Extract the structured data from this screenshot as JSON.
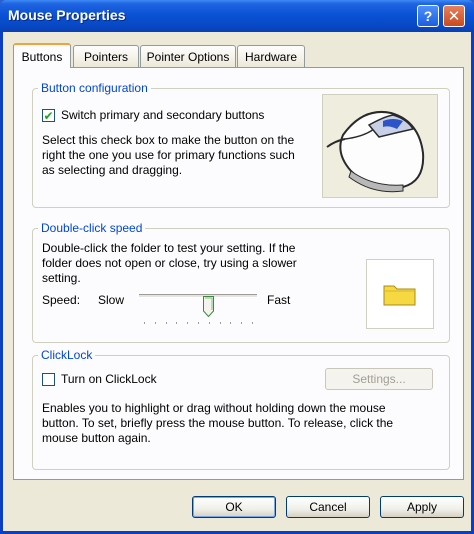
{
  "window": {
    "title": "Mouse Properties",
    "help_glyph": "?",
    "close_glyph": "✕"
  },
  "tabs": [
    {
      "label": "Buttons",
      "active": true
    },
    {
      "label": "Pointers",
      "active": false
    },
    {
      "label": "Pointer Options",
      "active": false
    },
    {
      "label": "Hardware",
      "active": false
    }
  ],
  "button_config": {
    "title": "Button configuration",
    "checkbox_label": "Switch primary and secondary buttons",
    "checked": true,
    "description_lines": [
      "Select this check box to make the button on the",
      "right the one you use for primary functions such",
      "as selecting and dragging."
    ],
    "image_icon": "mouse-icon"
  },
  "double_click": {
    "title": "Double-click speed",
    "description_lines": [
      "Double-click the folder to test your setting. If the",
      "folder does not open or close, try using a slower",
      "setting."
    ],
    "speed_label": "Speed:",
    "slow_label": "Slow",
    "fast_label": "Fast",
    "slider_value_fraction": 0.6,
    "image_icon": "folder-icon"
  },
  "clicklock": {
    "title": "ClickLock",
    "checkbox_label": "Turn on ClickLock",
    "checked": false,
    "settings_label": "Settings...",
    "description_lines": [
      "Enables you to highlight or drag without holding down the mouse",
      "button. To set, briefly press the mouse button. To release, click the",
      "mouse button again."
    ]
  },
  "footer": {
    "ok_label": "OK",
    "cancel_label": "Cancel",
    "apply_label": "Apply"
  },
  "colors": {
    "title_bar": "#0a52d6",
    "group_title": "#0046d5",
    "active_tab_accent": "#f2a13b",
    "folder": "#f5d842"
  }
}
